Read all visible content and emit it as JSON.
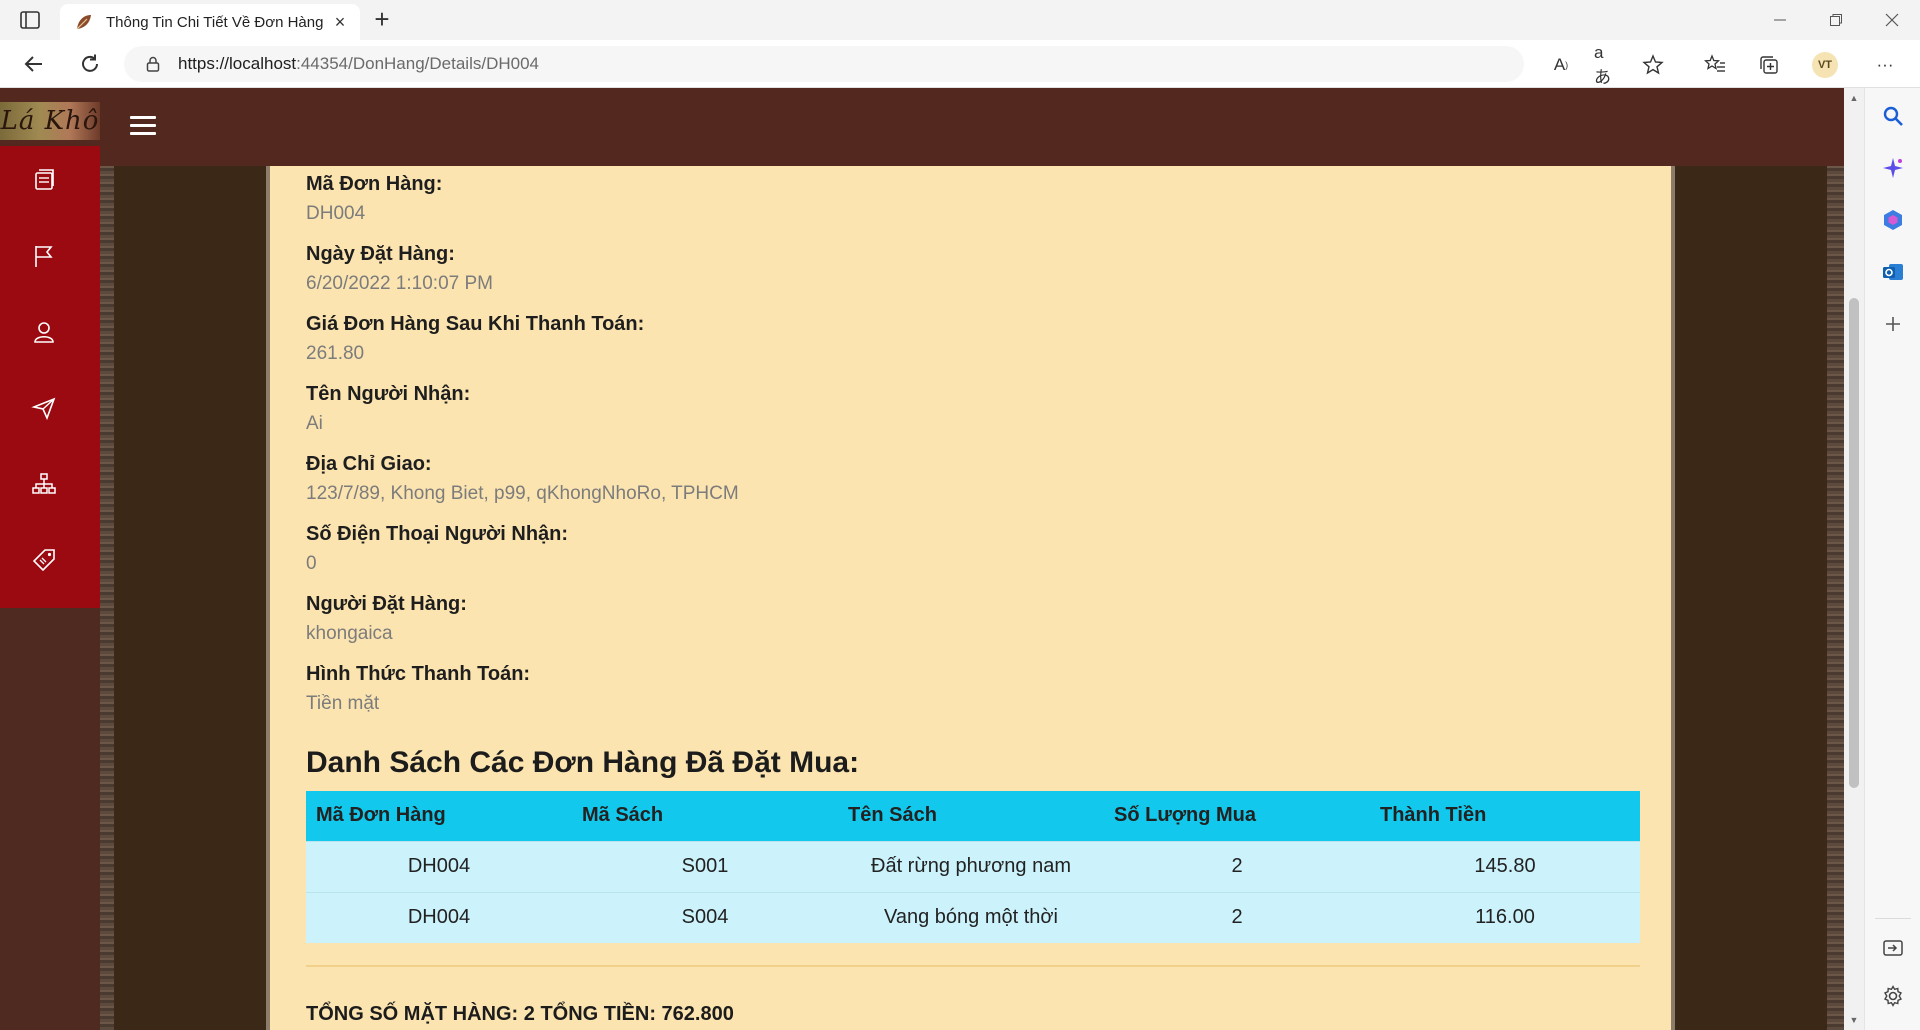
{
  "browser": {
    "tab_title": "Thông Tin Chi Tiết Về Đơn Hàng",
    "url_host": "https://localhost",
    "url_rest": ":44354/DonHang/Details/DH004",
    "profile_initials": "VT"
  },
  "site": {
    "logo_text": "Lá Khô"
  },
  "details": {
    "fields": [
      {
        "label": "Mã Đơn Hàng:",
        "value": "DH004"
      },
      {
        "label": "Ngày Đặt Hàng:",
        "value": "6/20/2022 1:10:07 PM"
      },
      {
        "label": "Giá Đơn Hàng Sau Khi Thanh Toán:",
        "value": "261.80"
      },
      {
        "label": "Tên Người Nhận:",
        "value": "Ai"
      },
      {
        "label": "Địa Chỉ Giao:",
        "value": "123/7/89, Khong Biet, p99, qKhongNhoRo, TPHCM"
      },
      {
        "label": "Số Điện Thoại Người Nhận:",
        "value": "0"
      },
      {
        "label": "Người Đặt Hàng:",
        "value": "khongaica"
      },
      {
        "label": "Hình Thức Thanh Toán:",
        "value": "Tiền mặt"
      }
    ]
  },
  "orders": {
    "title": "Danh Sách Các Đơn Hàng Đã Đặt Mua:",
    "headers": [
      "Mã Đơn Hàng",
      "Mã Sách",
      "Tên Sách",
      "Số Lượng Mua",
      "Thành Tiền"
    ],
    "rows": [
      [
        "DH004",
        "S001",
        "Đất rừng phương nam",
        "2",
        "145.80"
      ],
      [
        "DH004",
        "S004",
        "Vang bóng một thời",
        "2",
        "116.00"
      ]
    ],
    "summary": "TỔNG SỐ MẶT HÀNG: 2 TỔNG TIỀN: 762.800"
  }
}
